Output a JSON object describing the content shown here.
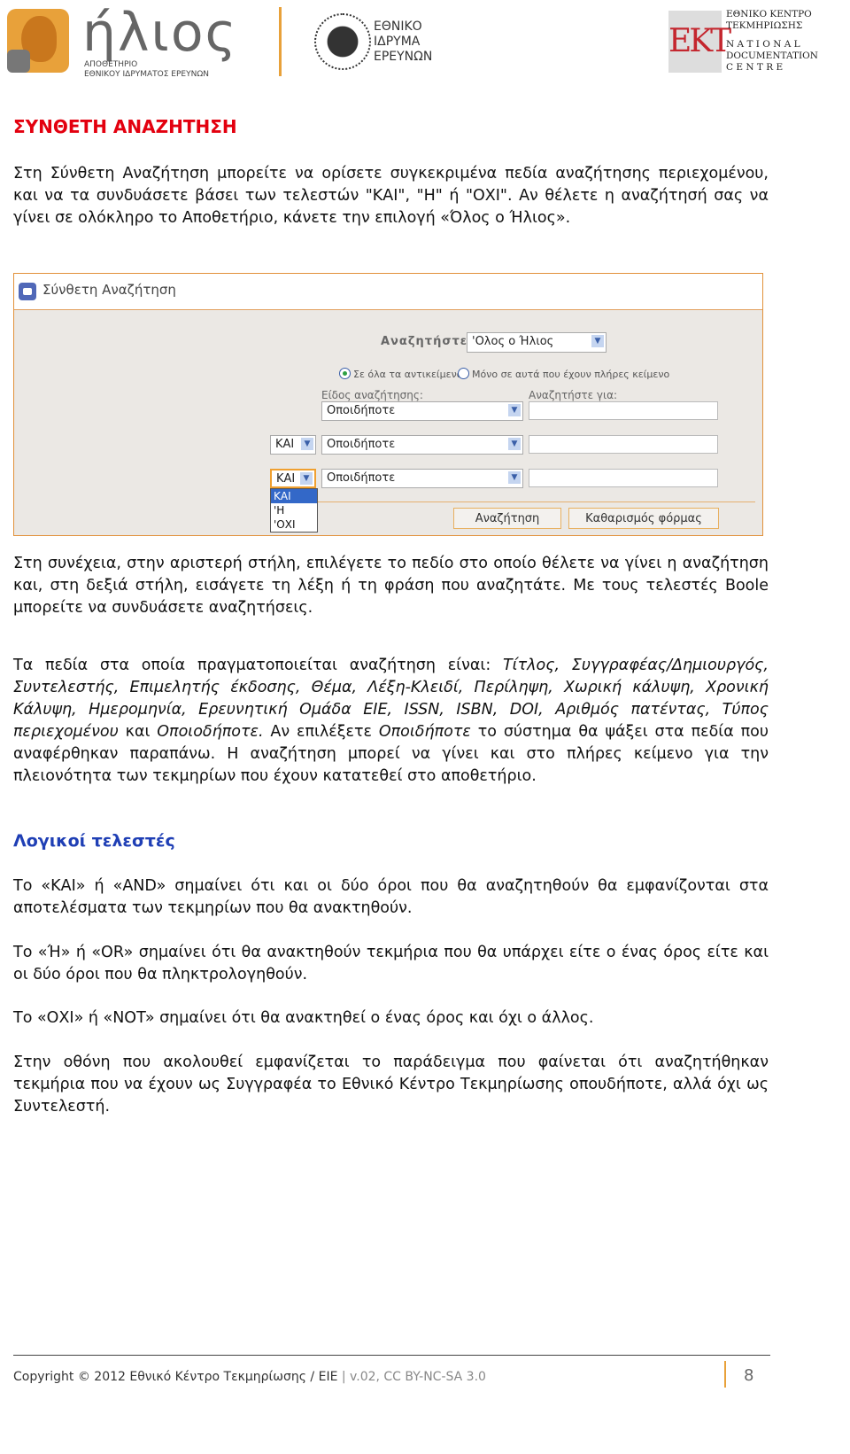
{
  "header": {
    "helios_word": "ήλιος",
    "helios_sub": [
      "ΑΠΟΘΕΤΗΡΙΟ",
      "ΕΘΝΙΚΟΥ ΙΔΡΥΜΑΤΟΣ ΕΡΕΥΝΩΝ"
    ],
    "eie": [
      "ΕΘΝΙΚΟ",
      "ΙΔΡΥΜΑ",
      "ΕΡΕΥΝΩΝ"
    ],
    "ekt_mark": "EKT",
    "ekt": [
      "ΕΘΝΙΚΟ ΚΕΝΤΡΟ",
      "ΤΕΚΜΗΡΙΩΣΗΣ",
      "N A T I O N A L",
      "DOCUMENTATION",
      "C E N T R E"
    ]
  },
  "title": "ΣΥΝΘΕΤΗ ΑΝΑΖΗΤΗΣΗ",
  "intro": "Στη Σύνθετη Αναζήτηση μπορείτε να ορίσετε συγκεκριμένα πεδία αναζήτησης περιεχομένου, και να τα συνδυάσετε βάσει των τελεστών \"ΚΑΙ\", \"Η\" ή \"ΟΧΙ\". Αν θέλετε η αναζήτησή σας να γίνει σε ολόκληρο το Αποθετήριο, κάνετε την επιλογή «Όλος ο Ήλιος».",
  "screenshot": {
    "title": "Σύνθετη Αναζήτηση",
    "search_in_label": "Αναζητήστε:",
    "search_in_value": "'Ολος ο Ήλιος",
    "radio_all": "Σε όλα τα αντικείμενα",
    "radio_fulltext": "Μόνο σε αυτά που έχουν πλήρες κείμενο",
    "type_label": "Είδος αναζήτησης:",
    "for_label": "Αναζητήστε για:",
    "field_value": "Οποιοδήποτε",
    "field_value_display": "Οποιδήποτε",
    "bool_value": "ΚΑΙ",
    "bool_options": [
      "ΚΑΙ",
      "'Η",
      "'ΟΧΙ"
    ],
    "search_button": "Αναζήτηση",
    "clear_button": "Καθαρισμός φόρμας"
  },
  "para2": "Στη συνέχεια, στην αριστερή στήλη, επιλέγετε το πεδίο στο οποίο θέλετε να γίνει η αναζήτηση και, στη δεξιά στήλη, εισάγετε τη λέξη ή τη φράση που αναζητάτε. Με τους τελεστές Boole μπορείτε να συνδυάσετε αναζητήσεις.",
  "para3": {
    "a": "Τα πεδία στα οποία πραγματοποιείται αναζήτηση είναι: ",
    "fields": "Τίτλος, Συγγραφέας/Δημιουργός, Συντελεστής, Επιμελητής έκδοσης, Θέμα, Λέξη-Κλειδί, Περίληψη, Χωρική κάλυψη, Χρονική Κάλυψη, Ημερομηνία, Ερευνητική Ομάδα ΕΙΕ, ISSN, ISBN, DOI, Αριθμός πατέντας, Τύπος περιεχομένου",
    "b": " και ",
    "any": "Οποιοδήποτε.",
    "c": " Αν επιλέξετε ",
    "any2": "Οποιδήποτε",
    "d": " το σύστημα θα ψάξει στα πεδία που αναφέρθηκαν παραπάνω. Η αναζήτηση μπορεί να γίνει και στο πλήρες κείμενο για την πλειονότητα των τεκμηρίων που έχουν κατατεθεί στο αποθετήριο."
  },
  "heading2": "Λογικοί τελεστές",
  "and_text": "Το «ΚΑΙ» ή «AND» σημαίνει ότι και οι δύο όροι που θα αναζητηθούν θα εμφανίζονται στα αποτελέσματα των τεκμηρίων που θα ανακτηθούν.",
  "or_text": "Το «Ή» ή «OR» σημαίνει ότι θα ανακτηθούν τεκμήρια που θα υπάρχει είτε ο ένας όρος είτε και οι δύο όροι που θα πληκτρολογηθούν.",
  "not_text": "Το «ΟΧΙ» ή «NOT» σημαίνει ότι θα ανακτηθεί ο ένας όρος και όχι ο άλλος.",
  "example_text": "Στην οθόνη που ακολουθεί εμφανίζεται το παράδειγμα που φαίνεται ότι αναζητήθηκαν τεκμήρια που να έχουν ως Συγγραφέα το Εθνικό Κέντρο Τεκμηρίωσης οπουδήποτε, αλλά όχι ως Συντελεστή.",
  "footer": {
    "copyright": "Copyright © 2012 Εθνικό Κέντρο Τεκμηρίωσης / ΕΙΕ",
    "sep": " | ",
    "version": "v.02,  CC BY-NC-SA 3.0",
    "page": "8"
  }
}
